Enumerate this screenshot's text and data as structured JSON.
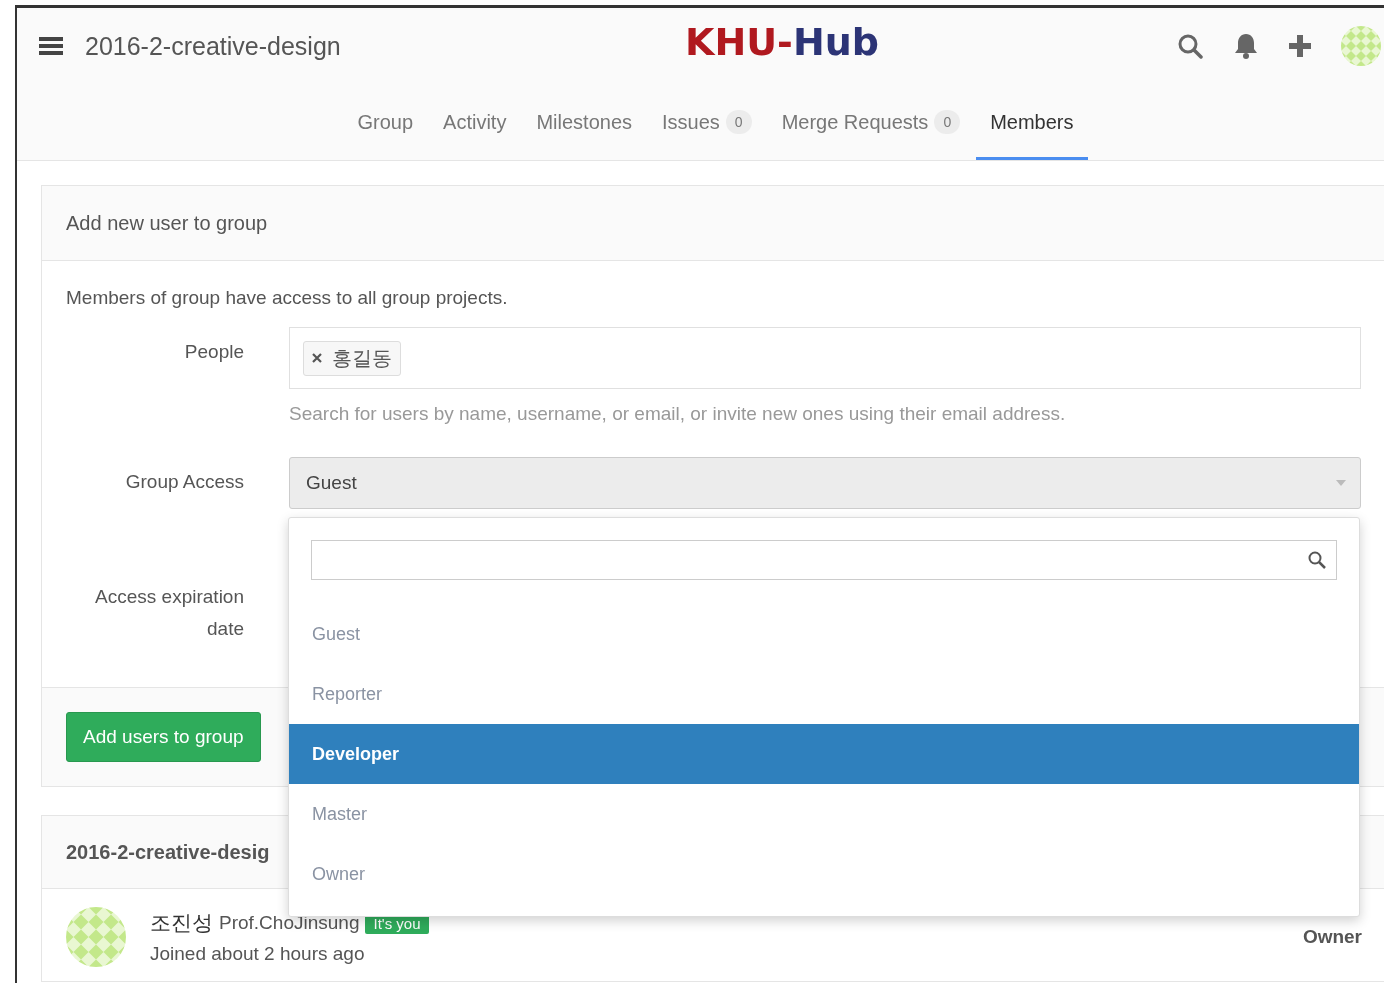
{
  "header": {
    "group_name": "2016-2-creative-design",
    "logo": [
      {
        "text": "KHU",
        "color": "#b0191f"
      },
      {
        "text": "-",
        "color": "#b0191f"
      },
      {
        "text": "Hub",
        "color": "#2c3476"
      }
    ]
  },
  "tabs": [
    {
      "label": "Group",
      "selected": false
    },
    {
      "label": "Activity",
      "selected": false
    },
    {
      "label": "Milestones",
      "selected": false
    },
    {
      "label": "Issues",
      "count": "0",
      "selected": false
    },
    {
      "label": "Merge Requests",
      "count": "0",
      "selected": false
    },
    {
      "label": "Members",
      "selected": true
    }
  ],
  "add_panel": {
    "title": "Add new user to group",
    "intro": "Members of group have access to all group projects.",
    "people_label": "People",
    "people_tokens": [
      "홍길동"
    ],
    "people_help": "Search for users by name, username, or email, or invite new ones using their email address.",
    "access_label": "Group Access",
    "access_value": "Guest",
    "expiration_label": "Access expiration date",
    "submit": "Add users to group"
  },
  "access_dropdown": {
    "options": [
      {
        "label": "Guest",
        "selected": false
      },
      {
        "label": "Reporter",
        "selected": false
      },
      {
        "label": "Developer",
        "selected": true
      },
      {
        "label": "Master",
        "selected": false
      },
      {
        "label": "Owner",
        "selected": false
      }
    ]
  },
  "members_panel": {
    "title": "2016-2-creative-desig",
    "members": [
      {
        "name": "조진성",
        "username": "Prof.ChoJinsung",
        "badge": "It's you",
        "joined": "Joined about 2 hours ago",
        "role": "Owner"
      }
    ]
  }
}
